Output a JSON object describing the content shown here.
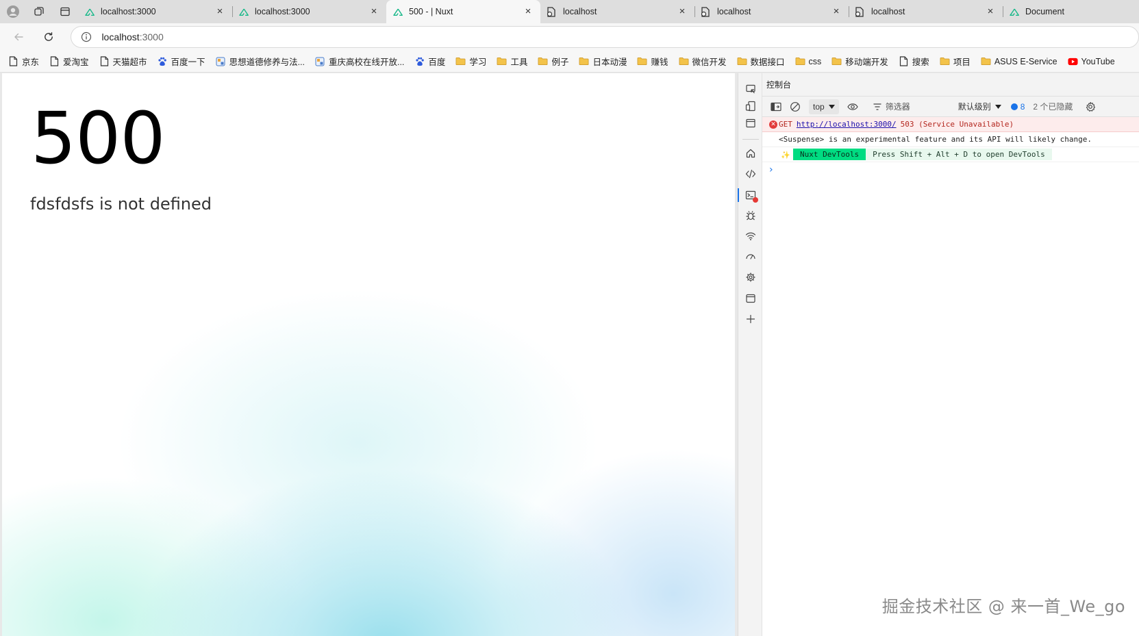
{
  "tabs": [
    {
      "title": "localhost:3000",
      "icon": "nuxt-icon",
      "active": false
    },
    {
      "title": "localhost:3000",
      "icon": "nuxt-icon",
      "active": false
    },
    {
      "title": "500 - | Nuxt",
      "icon": "nuxt-icon",
      "active": true
    },
    {
      "title": "localhost",
      "icon": "page-icon",
      "active": false
    },
    {
      "title": "localhost",
      "icon": "page-icon",
      "active": false
    },
    {
      "title": "localhost",
      "icon": "page-icon",
      "active": false
    },
    {
      "title": "Document",
      "icon": "nuxt-icon",
      "active": false
    }
  ],
  "tab_close_glyph": "×",
  "address": {
    "host": "localhost",
    "port": ":3000"
  },
  "bookmarks": [
    {
      "label": "京东",
      "icon": "page-icon"
    },
    {
      "label": "爱淘宝",
      "icon": "page-icon"
    },
    {
      "label": "天猫超市",
      "icon": "page-icon"
    },
    {
      "label": "百度一下",
      "icon": "baidu-icon"
    },
    {
      "label": "思想道德修养与法...",
      "icon": "site-icon"
    },
    {
      "label": "重庆高校在线开放...",
      "icon": "site-icon"
    },
    {
      "label": "百度",
      "icon": "baidu-icon"
    },
    {
      "label": "学习",
      "icon": "folder-icon"
    },
    {
      "label": "工具",
      "icon": "folder-icon"
    },
    {
      "label": "例子",
      "icon": "folder-icon"
    },
    {
      "label": "日本动漫",
      "icon": "folder-icon"
    },
    {
      "label": "赚钱",
      "icon": "folder-icon"
    },
    {
      "label": "微信开发",
      "icon": "folder-icon"
    },
    {
      "label": "数据接口",
      "icon": "folder-icon"
    },
    {
      "label": "css",
      "icon": "folder-icon"
    },
    {
      "label": "移动端开发",
      "icon": "folder-icon"
    },
    {
      "label": "搜索",
      "icon": "page-icon"
    },
    {
      "label": "项目",
      "icon": "folder-icon"
    },
    {
      "label": "ASUS E-Service",
      "icon": "folder-icon"
    },
    {
      "label": "YouTube",
      "icon": "youtube-icon"
    }
  ],
  "page": {
    "status_code": "500",
    "message": "fdsfdsfs is not defined"
  },
  "devtools": {
    "panel_title": "控制台",
    "context": "top",
    "filter_label": "筛选器",
    "level_label": "默认级别",
    "message_count": "8",
    "hidden_label": "2 个已隐藏",
    "logs": {
      "error_method": "GET",
      "error_url": "http://localhost:3000/",
      "error_status": "503 (Service Unavailable)",
      "warning_text": "<Suspense> is an experimental feature and its API will likely change.",
      "nuxt_pill": "Nuxt DevTools",
      "nuxt_hint": "Press Shift + Alt + D to open DevTools"
    },
    "prompt": "›"
  },
  "watermark": "掘金技术社区 @ 来一首_We_go",
  "colors": {
    "accent_blue": "#1a73e8",
    "error_red": "#e23b3b",
    "nuxt_green": "#00dc82"
  }
}
